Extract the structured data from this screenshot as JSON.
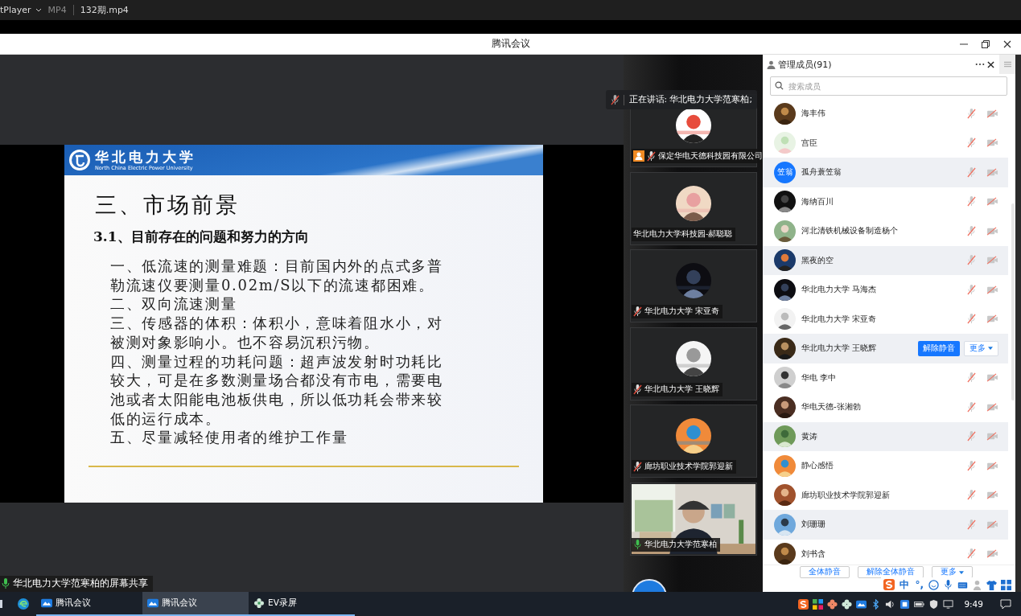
{
  "player_bar": {
    "app": "tPlayer",
    "format": "MP4",
    "file": "132期.mp4"
  },
  "window": {
    "title": "腾讯会议"
  },
  "slide": {
    "university": "华北电力大学",
    "university_en": "North China Electric Power University",
    "title": "三、市场前景",
    "subtitle": "3.1、目前存在的问题和努力的方向",
    "points": [
      "一、低流速的测量难题：目前国内外的点式多普勒流速仪要测量0.02m/S以下的流速都困难。",
      "二、双向流速测量",
      "三、传感器的体积：体积小，意味着阻水小，对被测对象影响小。也不容易沉积污物。",
      "四、测量过程的功耗问题：超声波发射时功耗比较大，可是在多数测量场合都没有市电，需要电池或者太阳能电池板供电，所以低功耗会带来较低的运行成本。",
      "五、尽量减轻使用者的维护工作量"
    ]
  },
  "share_label": "华北电力大学范寒柏的屏幕共享",
  "speaking": "正在讲话: 华北电力大学范寒柏;",
  "video_tiles": [
    {
      "kind": "avatar",
      "name": "保定华电天德科技园有限公司",
      "host": true,
      "mic_muted": true
    },
    {
      "kind": "avatar",
      "name": "华北电力大学科技园-郝聪聪",
      "host": false
    },
    {
      "kind": "avatar",
      "name": "华北电力大学 宋亚奇",
      "host": false,
      "mic_muted": true
    },
    {
      "kind": "avatar",
      "name": "华北电力大学 王晓辉",
      "host": false,
      "mic_muted": true
    },
    {
      "kind": "avatar",
      "name": "廊坊职业技术学院郭迎新",
      "host": false,
      "mic_muted": true
    },
    {
      "kind": "video",
      "name": "华北电力大学范寒柏",
      "host": false,
      "mic_muted": false
    }
  ],
  "members": {
    "title": "管理成员(91)",
    "search": {
      "placeholder": "搜索成员"
    },
    "rows": [
      {
        "name": "海丰伟",
        "mic_muted": true,
        "camera_off": true,
        "hovered": false
      },
      {
        "name": "宫臣",
        "mic_muted": true,
        "camera_off": true,
        "hovered": false
      },
      {
        "name": "孤舟蓑笠翁",
        "avatar_text": "笠翁",
        "mic_muted": true,
        "camera_off": true,
        "hovered": false
      },
      {
        "name": "海纳百川",
        "mic_muted": true,
        "camera_off": true,
        "hovered": false
      },
      {
        "name": "河北清铁机械设备制造杨个",
        "mic_muted": true,
        "camera_off": true,
        "hovered": false
      },
      {
        "name": "黑夜的空",
        "mic_muted": true,
        "camera_off": true,
        "hovered": false
      },
      {
        "name": "华北电力大学 马海杰",
        "mic_muted": true,
        "camera_off": true,
        "hovered": false
      },
      {
        "name": "华北电力大学 宋亚奇",
        "mic_muted": true,
        "camera_off": true,
        "hovered": false
      },
      {
        "name": "华北电力大学 王晓辉",
        "hovered": true,
        "actions": [
          "解除静音",
          "更多"
        ]
      },
      {
        "name": "华电 李中",
        "mic_muted": true,
        "camera_off": true,
        "hovered": false
      },
      {
        "name": "华电天德-张湘勃",
        "mic_muted": true,
        "camera_off": true,
        "hovered": false
      },
      {
        "name": "黄涛",
        "mic_muted": true,
        "camera_off": true,
        "hovered": false
      },
      {
        "name": "静心感悟",
        "mic_muted": true,
        "camera_off": true,
        "hovered": false
      },
      {
        "name": "廊坊职业技术学院郭迎新",
        "mic_muted": true,
        "camera_off": true,
        "hovered": false
      },
      {
        "name": "刘珊珊",
        "mic_muted": true,
        "camera_off": true,
        "hovered": false
      },
      {
        "name": "刘书含",
        "mic_muted": true,
        "camera_off": true,
        "hovered": false
      }
    ],
    "footer_buttons": [
      "全体静音",
      "解除全体静音",
      "更多"
    ]
  },
  "ime": {
    "mode": "中",
    "punct": "°,"
  },
  "taskbar": {
    "apps": [
      {
        "label": "腾讯会议",
        "kind": "meeting",
        "selected": false
      },
      {
        "label": "腾讯会议",
        "kind": "meeting",
        "selected": true
      },
      {
        "label": "EV录屏",
        "kind": "recorder",
        "selected": false
      }
    ],
    "time": "9:49"
  }
}
